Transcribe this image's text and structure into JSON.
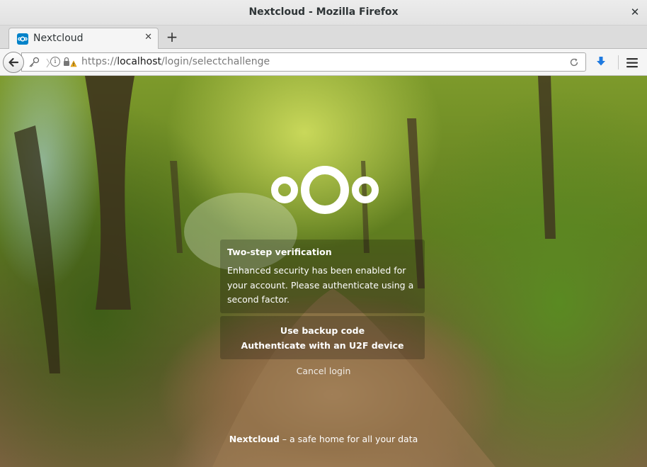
{
  "window": {
    "title": "Nextcloud - Mozilla Firefox",
    "close_glyph": "✕"
  },
  "tabs": [
    {
      "label": "Nextcloud",
      "close_glyph": "✕",
      "icon": "nextcloud-favicon"
    }
  ],
  "new_tab_glyph": "+",
  "urlbar": {
    "scheme": "https://",
    "host": "localhost",
    "path": "/login/selectchallenge",
    "icons": [
      "key-icon",
      "info-icon",
      "lock-warning-icon",
      "reload-icon"
    ],
    "info_glyph": "i"
  },
  "toolbar": {
    "icons": [
      "download-icon",
      "hamburger-menu-icon"
    ],
    "download_color": "#1f7ae0"
  },
  "page": {
    "logo": "nextcloud-logo",
    "panel": {
      "title": "Two-step verification",
      "text": "Enhanced security has been enabled for your account. Please authenticate using a second factor."
    },
    "options": [
      "Use backup code",
      "Authenticate with an U2F device"
    ],
    "cancel_label": "Cancel login",
    "footer": {
      "brand": "Nextcloud",
      "tagline": " – a safe home for all your data"
    }
  }
}
